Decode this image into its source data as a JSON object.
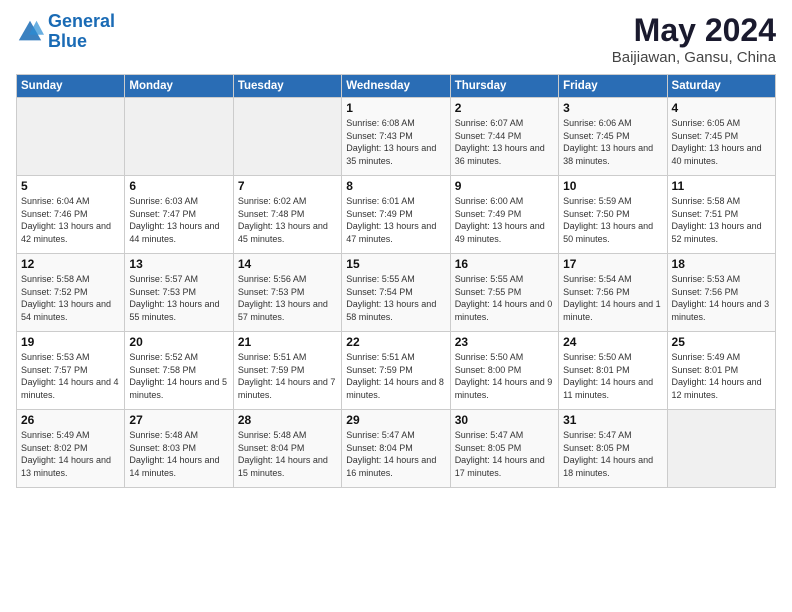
{
  "header": {
    "logo_line1": "General",
    "logo_line2": "Blue",
    "title": "May 2024",
    "subtitle": "Baijiawan, Gansu, China"
  },
  "weekdays": [
    "Sunday",
    "Monday",
    "Tuesday",
    "Wednesday",
    "Thursday",
    "Friday",
    "Saturday"
  ],
  "weeks": [
    [
      {
        "day": "",
        "sunrise": "",
        "sunset": "",
        "daylight": ""
      },
      {
        "day": "",
        "sunrise": "",
        "sunset": "",
        "daylight": ""
      },
      {
        "day": "",
        "sunrise": "",
        "sunset": "",
        "daylight": ""
      },
      {
        "day": "1",
        "sunrise": "Sunrise: 6:08 AM",
        "sunset": "Sunset: 7:43 PM",
        "daylight": "Daylight: 13 hours and 35 minutes."
      },
      {
        "day": "2",
        "sunrise": "Sunrise: 6:07 AM",
        "sunset": "Sunset: 7:44 PM",
        "daylight": "Daylight: 13 hours and 36 minutes."
      },
      {
        "day": "3",
        "sunrise": "Sunrise: 6:06 AM",
        "sunset": "Sunset: 7:45 PM",
        "daylight": "Daylight: 13 hours and 38 minutes."
      },
      {
        "day": "4",
        "sunrise": "Sunrise: 6:05 AM",
        "sunset": "Sunset: 7:45 PM",
        "daylight": "Daylight: 13 hours and 40 minutes."
      }
    ],
    [
      {
        "day": "5",
        "sunrise": "Sunrise: 6:04 AM",
        "sunset": "Sunset: 7:46 PM",
        "daylight": "Daylight: 13 hours and 42 minutes."
      },
      {
        "day": "6",
        "sunrise": "Sunrise: 6:03 AM",
        "sunset": "Sunset: 7:47 PM",
        "daylight": "Daylight: 13 hours and 44 minutes."
      },
      {
        "day": "7",
        "sunrise": "Sunrise: 6:02 AM",
        "sunset": "Sunset: 7:48 PM",
        "daylight": "Daylight: 13 hours and 45 minutes."
      },
      {
        "day": "8",
        "sunrise": "Sunrise: 6:01 AM",
        "sunset": "Sunset: 7:49 PM",
        "daylight": "Daylight: 13 hours and 47 minutes."
      },
      {
        "day": "9",
        "sunrise": "Sunrise: 6:00 AM",
        "sunset": "Sunset: 7:49 PM",
        "daylight": "Daylight: 13 hours and 49 minutes."
      },
      {
        "day": "10",
        "sunrise": "Sunrise: 5:59 AM",
        "sunset": "Sunset: 7:50 PM",
        "daylight": "Daylight: 13 hours and 50 minutes."
      },
      {
        "day": "11",
        "sunrise": "Sunrise: 5:58 AM",
        "sunset": "Sunset: 7:51 PM",
        "daylight": "Daylight: 13 hours and 52 minutes."
      }
    ],
    [
      {
        "day": "12",
        "sunrise": "Sunrise: 5:58 AM",
        "sunset": "Sunset: 7:52 PM",
        "daylight": "Daylight: 13 hours and 54 minutes."
      },
      {
        "day": "13",
        "sunrise": "Sunrise: 5:57 AM",
        "sunset": "Sunset: 7:53 PM",
        "daylight": "Daylight: 13 hours and 55 minutes."
      },
      {
        "day": "14",
        "sunrise": "Sunrise: 5:56 AM",
        "sunset": "Sunset: 7:53 PM",
        "daylight": "Daylight: 13 hours and 57 minutes."
      },
      {
        "day": "15",
        "sunrise": "Sunrise: 5:55 AM",
        "sunset": "Sunset: 7:54 PM",
        "daylight": "Daylight: 13 hours and 58 minutes."
      },
      {
        "day": "16",
        "sunrise": "Sunrise: 5:55 AM",
        "sunset": "Sunset: 7:55 PM",
        "daylight": "Daylight: 14 hours and 0 minutes."
      },
      {
        "day": "17",
        "sunrise": "Sunrise: 5:54 AM",
        "sunset": "Sunset: 7:56 PM",
        "daylight": "Daylight: 14 hours and 1 minute."
      },
      {
        "day": "18",
        "sunrise": "Sunrise: 5:53 AM",
        "sunset": "Sunset: 7:56 PM",
        "daylight": "Daylight: 14 hours and 3 minutes."
      }
    ],
    [
      {
        "day": "19",
        "sunrise": "Sunrise: 5:53 AM",
        "sunset": "Sunset: 7:57 PM",
        "daylight": "Daylight: 14 hours and 4 minutes."
      },
      {
        "day": "20",
        "sunrise": "Sunrise: 5:52 AM",
        "sunset": "Sunset: 7:58 PM",
        "daylight": "Daylight: 14 hours and 5 minutes."
      },
      {
        "day": "21",
        "sunrise": "Sunrise: 5:51 AM",
        "sunset": "Sunset: 7:59 PM",
        "daylight": "Daylight: 14 hours and 7 minutes."
      },
      {
        "day": "22",
        "sunrise": "Sunrise: 5:51 AM",
        "sunset": "Sunset: 7:59 PM",
        "daylight": "Daylight: 14 hours and 8 minutes."
      },
      {
        "day": "23",
        "sunrise": "Sunrise: 5:50 AM",
        "sunset": "Sunset: 8:00 PM",
        "daylight": "Daylight: 14 hours and 9 minutes."
      },
      {
        "day": "24",
        "sunrise": "Sunrise: 5:50 AM",
        "sunset": "Sunset: 8:01 PM",
        "daylight": "Daylight: 14 hours and 11 minutes."
      },
      {
        "day": "25",
        "sunrise": "Sunrise: 5:49 AM",
        "sunset": "Sunset: 8:01 PM",
        "daylight": "Daylight: 14 hours and 12 minutes."
      }
    ],
    [
      {
        "day": "26",
        "sunrise": "Sunrise: 5:49 AM",
        "sunset": "Sunset: 8:02 PM",
        "daylight": "Daylight: 14 hours and 13 minutes."
      },
      {
        "day": "27",
        "sunrise": "Sunrise: 5:48 AM",
        "sunset": "Sunset: 8:03 PM",
        "daylight": "Daylight: 14 hours and 14 minutes."
      },
      {
        "day": "28",
        "sunrise": "Sunrise: 5:48 AM",
        "sunset": "Sunset: 8:04 PM",
        "daylight": "Daylight: 14 hours and 15 minutes."
      },
      {
        "day": "29",
        "sunrise": "Sunrise: 5:47 AM",
        "sunset": "Sunset: 8:04 PM",
        "daylight": "Daylight: 14 hours and 16 minutes."
      },
      {
        "day": "30",
        "sunrise": "Sunrise: 5:47 AM",
        "sunset": "Sunset: 8:05 PM",
        "daylight": "Daylight: 14 hours and 17 minutes."
      },
      {
        "day": "31",
        "sunrise": "Sunrise: 5:47 AM",
        "sunset": "Sunset: 8:05 PM",
        "daylight": "Daylight: 14 hours and 18 minutes."
      },
      {
        "day": "",
        "sunrise": "",
        "sunset": "",
        "daylight": ""
      }
    ]
  ]
}
